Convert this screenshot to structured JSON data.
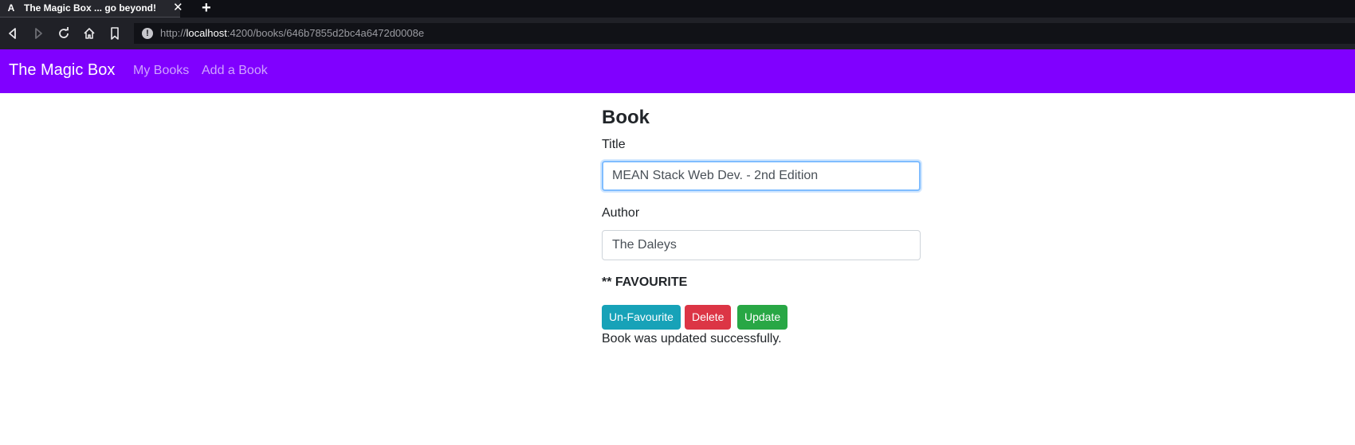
{
  "browser": {
    "tab_title": "The Magic Box ... go beyond!",
    "tab_favicon": "A",
    "tab_close": "✕",
    "new_tab": "+",
    "url_scheme": "http://",
    "url_host": "localhost",
    "url_rest": ":4200/books/646b7855d2bc4a6472d0008e",
    "icons": {
      "back": "back-arrow-icon",
      "forward": "forward-arrow-icon",
      "reload": "reload-icon",
      "home": "home-icon",
      "bookmark": "bookmark-icon",
      "info": "info-icon"
    }
  },
  "navbar": {
    "brand": "The Magic Box",
    "links": [
      "My Books",
      "Add a Book"
    ],
    "color": "#8000ff"
  },
  "form": {
    "heading": "Book",
    "title_label": "Title",
    "title_value": "MEAN Stack Web Dev. - 2nd Edition",
    "author_label": "Author",
    "author_value": "The Daleys",
    "favourite_text": "** FAVOURITE",
    "buttons": {
      "unfavourite": "Un-Favourite",
      "delete": "Delete",
      "update": "Update"
    },
    "message": "Book was updated successfully."
  },
  "colors": {
    "info": "#17a2b8",
    "danger": "#dc3545",
    "success": "#28a745"
  }
}
